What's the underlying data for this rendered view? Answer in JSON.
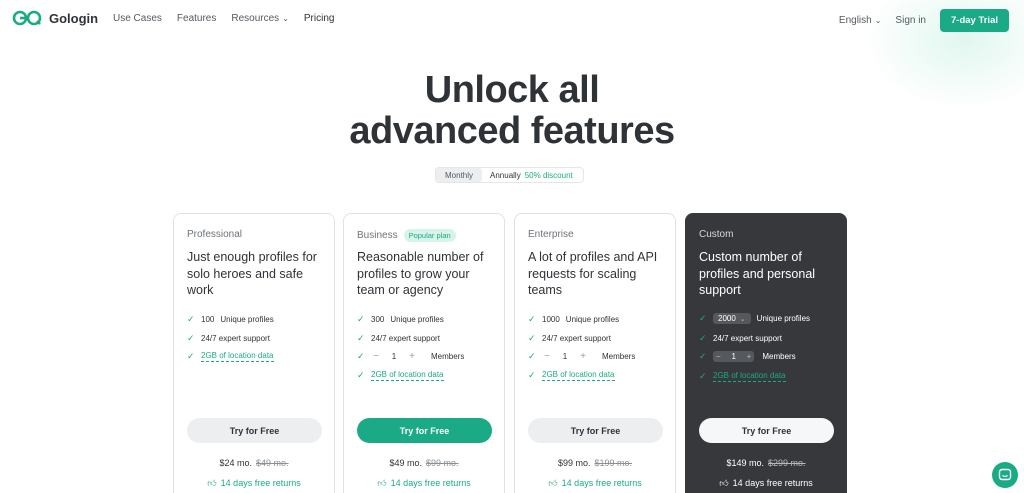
{
  "nav": {
    "brand": "Gologin",
    "links": [
      "Use Cases",
      "Features",
      "Resources",
      "Pricing"
    ],
    "language": "English",
    "sign_in": "Sign in",
    "trial": "7-day Trial"
  },
  "hero": {
    "line1": "Unlock all",
    "line2": "advanced features"
  },
  "billing": {
    "monthly": "Monthly",
    "annually": "Annually",
    "discount": "50% discount"
  },
  "plans": [
    {
      "tier": "Professional",
      "headline": "Just enough profiles for solo heroes and safe work",
      "profiles": "100",
      "profiles_label": "Unique profiles",
      "support": "24/7 expert support",
      "location": "2GB of location data",
      "cta": "Try for Free",
      "price": "$24 mo.",
      "old_price": "$49 mo.",
      "returns": "14 days free returns"
    },
    {
      "tier": "Business",
      "badge": "Popular plan",
      "headline": "Reasonable number of profiles to grow your team or agency",
      "profiles": "300",
      "profiles_label": "Unique profiles",
      "support": "24/7 expert support",
      "members": "1",
      "members_label": "Members",
      "location": "2GB of location data",
      "cta": "Try for Free",
      "price": "$49 mo.",
      "old_price": "$99 mo.",
      "returns": "14 days free returns"
    },
    {
      "tier": "Enterprise",
      "headline": "A lot of profiles and API requests for scaling teams",
      "profiles": "1000",
      "profiles_label": "Unique profiles",
      "support": "24/7 expert support",
      "members": "1",
      "members_label": "Members",
      "location": "2GB of location data",
      "cta": "Try for Free",
      "price": "$99 mo.",
      "old_price": "$199 mo.",
      "returns": "14 days free returns"
    },
    {
      "tier": "Custom",
      "headline": "Custom number of profiles and personal support",
      "profiles": "2000",
      "profiles_label": "Unique profiles",
      "support": "24/7 expert support",
      "members": "1",
      "members_label": "Members",
      "location": "2GB of location data",
      "cta": "Try for Free",
      "price": "$149 mo.",
      "old_price": "$299 mo.",
      "returns": "14 days free returns"
    }
  ],
  "colors": {
    "accent": "#1aab86",
    "dark_card": "#36383b",
    "text": "#2f3337"
  },
  "icons": {
    "check": "check-icon",
    "thumb": "thumbs-up-icon",
    "chat": "chat-icon"
  }
}
